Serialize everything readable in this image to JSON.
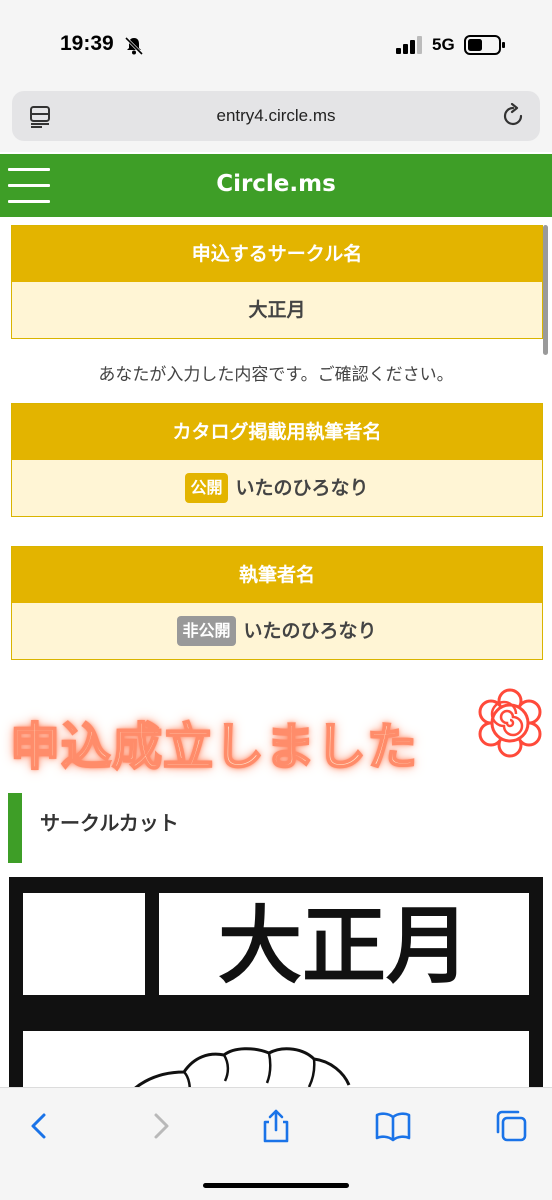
{
  "status_bar": {
    "time": "19:39",
    "network": "5G"
  },
  "browser": {
    "url": "entry4.circle.ms"
  },
  "header": {
    "brand": "Circle.ms"
  },
  "circle_name": {
    "heading": "申込するサークル名",
    "value": "大正月"
  },
  "confirm_note": "あなたが入力した内容です。ご確認ください。",
  "catalog_author": {
    "heading": "カタログ掲載用執筆者名",
    "badge": "公開",
    "value": "いたのひろなり"
  },
  "author": {
    "heading": "執筆者名",
    "badge": "非公開",
    "value": "いたのひろなり"
  },
  "overlay_text": "申込成立しました",
  "section": {
    "title": "サークルカット"
  },
  "circle_cut": {
    "text": "大正月"
  },
  "colors": {
    "header_green": "#3e9e27",
    "card_gold": "#e3b400",
    "card_cream": "#fff5d5",
    "private_gray": "#999999"
  },
  "toolbar": {
    "icons": [
      "back-icon",
      "forward-icon",
      "share-icon",
      "bookmarks-icon",
      "tabs-icon"
    ]
  }
}
